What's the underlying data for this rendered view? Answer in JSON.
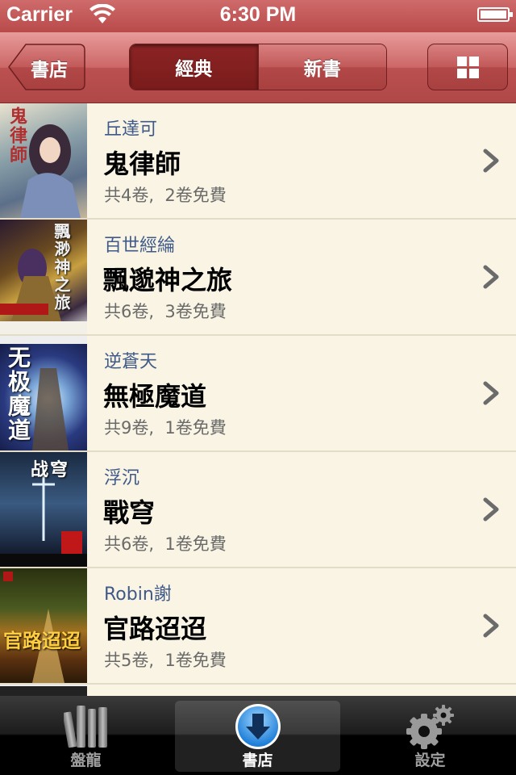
{
  "status_bar": {
    "carrier": "Carrier",
    "time": "6:30 PM"
  },
  "nav": {
    "back_label": "書店",
    "segments": [
      {
        "label": "經典",
        "selected": true
      },
      {
        "label": "新書",
        "selected": false
      }
    ],
    "grid_icon": "grid-icon"
  },
  "books": [
    {
      "author": "丘達可",
      "title": "鬼律師",
      "meta": "共4卷,  2卷免費",
      "cover_text": "鬼律師"
    },
    {
      "author": "百世經綸",
      "title": "飄邈神之旅",
      "meta": "共6卷,  3卷免費",
      "cover_text": "飄渺神之旅"
    },
    {
      "author": "逆蒼天",
      "title": "無極魔道",
      "meta": "共9卷,  1卷免費",
      "cover_text": "无极魔道"
    },
    {
      "author": "浮沉",
      "title": "戰穹",
      "meta": "共6卷,  1卷免費",
      "cover_text": "战穹"
    },
    {
      "author": "Robin謝",
      "title": "官路迢迢",
      "meta": "共5卷,  1卷免費",
      "cover_text": "官路迢迢"
    }
  ],
  "tabs": [
    {
      "label": "盤龍",
      "icon": "books-icon",
      "selected": false
    },
    {
      "label": "書店",
      "icon": "download-icon",
      "selected": true
    },
    {
      "label": "設定",
      "icon": "gear-icon",
      "selected": false
    }
  ]
}
